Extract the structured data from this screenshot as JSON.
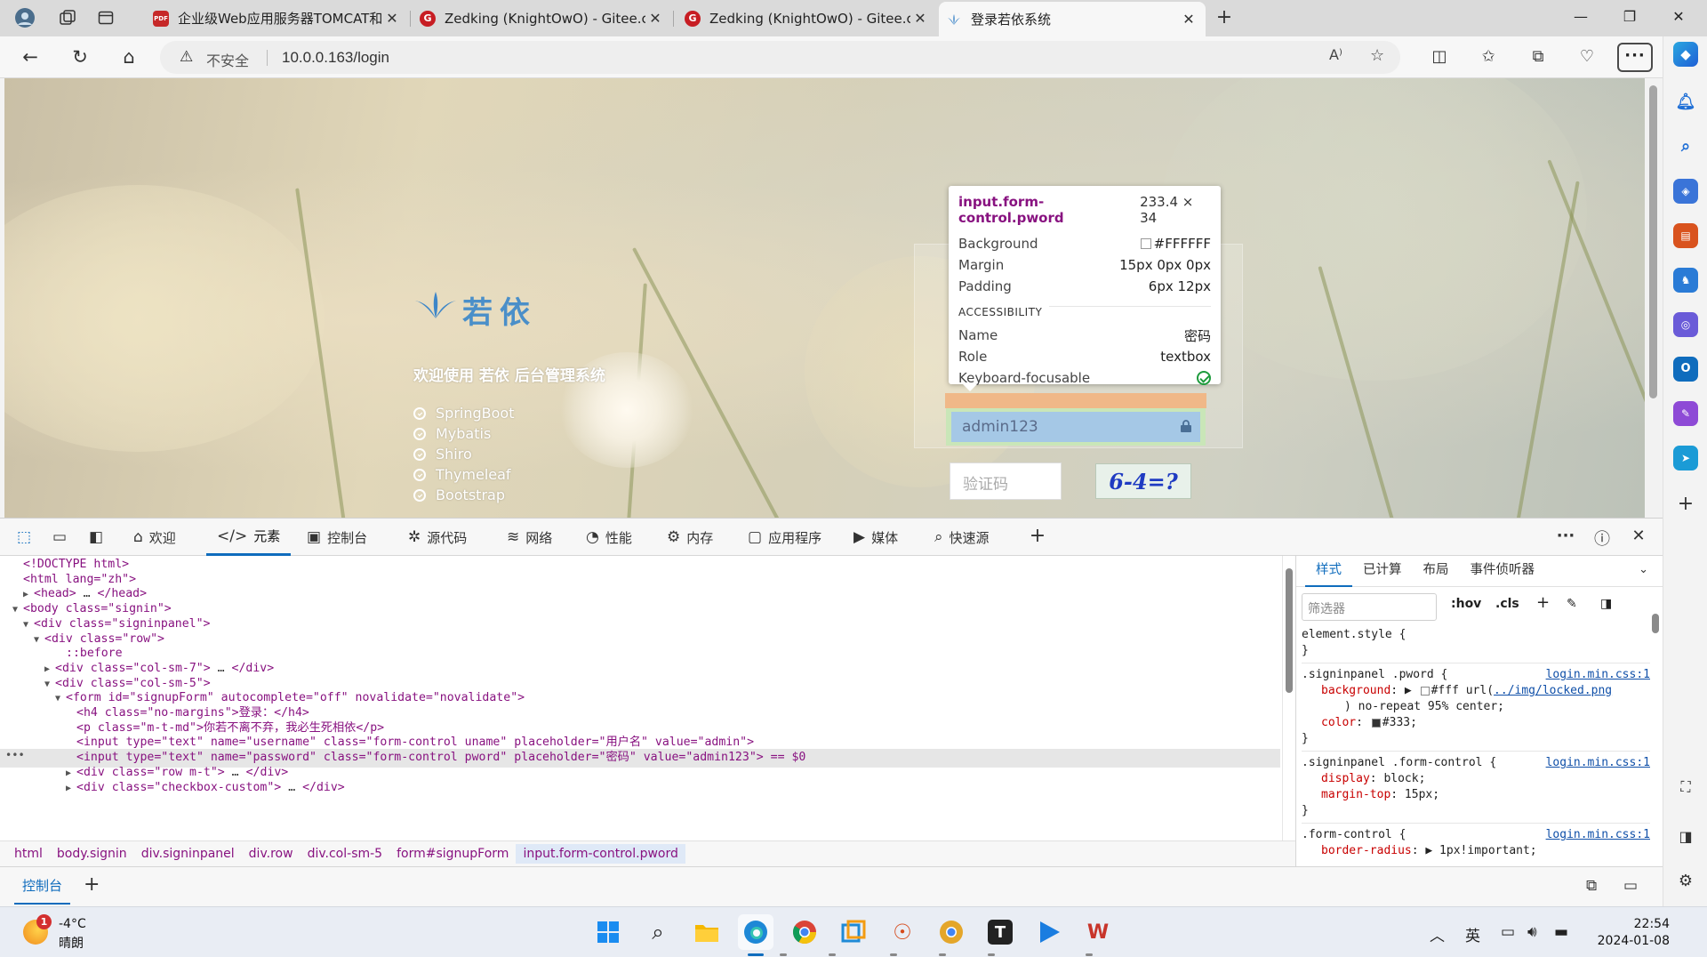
{
  "browser": {
    "tabs": [
      {
        "title": "企业级Web应用服务器TOMCAT和",
        "favicon_color": "#c62828",
        "favicon_glyph": "PDF",
        "active": false
      },
      {
        "title": "Zedking (KnightOwO) - Gitee.cor",
        "favicon_color": "#c71d23",
        "favicon_glyph": "G",
        "active": false
      },
      {
        "title": "Zedking (KnightOwO) - Gitee.cor",
        "favicon_color": "#c71d23",
        "favicon_glyph": "G",
        "active": false
      },
      {
        "title": "登录若依系统",
        "favicon_color": "#3d86c8",
        "favicon_glyph": "ruoyi-leaf-icon",
        "active": true
      }
    ],
    "address": {
      "security_label": "不安全",
      "url": "10.0.0.163/login"
    }
  },
  "page": {
    "logo_text": "若依",
    "welcome": "欢迎使用 若依 后台管理系统",
    "features": [
      "SpringBoot",
      "Mybatis",
      "Shiro",
      "Thymeleaf",
      "Bootstrap"
    ],
    "password_value": "admin123",
    "captcha_placeholder": "验证码",
    "captcha_text": "6-4=?"
  },
  "tooltip": {
    "selector": "input.form-control.pword",
    "size": "233.4 × 34",
    "rows": [
      {
        "label": "Background",
        "value": "#FFFFFF",
        "swatch": "#FFFFFF"
      },
      {
        "label": "Margin",
        "value": "15px 0px 0px"
      },
      {
        "label": "Padding",
        "value": "6px 12px"
      }
    ],
    "accessibility_title": "ACCESSIBILITY",
    "a11y_rows": [
      {
        "label": "Name",
        "value": "密码"
      },
      {
        "label": "Role",
        "value": "textbox"
      },
      {
        "label": "Keyboard-focusable",
        "value": ""
      }
    ]
  },
  "devtools": {
    "tabs": [
      {
        "label": "欢迎",
        "icon": "home-icon"
      },
      {
        "label": "元素",
        "icon": "code-icon",
        "active": true
      },
      {
        "label": "控制台",
        "icon": "console-icon"
      },
      {
        "label": "源代码",
        "icon": "bug-icon"
      },
      {
        "label": "网络",
        "icon": "wifi-icon"
      },
      {
        "label": "性能",
        "icon": "gauge-icon"
      },
      {
        "label": "内存",
        "icon": "memory-icon"
      },
      {
        "label": "应用程序",
        "icon": "app-icon"
      },
      {
        "label": "媒体",
        "icon": "play-icon"
      },
      {
        "label": "快速源",
        "icon": "quicksource-icon"
      }
    ],
    "dom_lines": [
      {
        "indent": 0,
        "twisty": "",
        "text": "<!DOCTYPE html>"
      },
      {
        "indent": 0,
        "twisty": "",
        "text": "<html lang=\"zh\">"
      },
      {
        "indent": 1,
        "twisty": "▶",
        "text": "<head>",
        "tail": "</head>",
        "collapsed": true
      },
      {
        "indent": 0,
        "twisty": "▼",
        "text": "<body class=\"signin\">"
      },
      {
        "indent": 1,
        "twisty": "▼",
        "text": "<div class=\"signinpanel\">"
      },
      {
        "indent": 2,
        "twisty": "▼",
        "text": "<div class=\"row\">"
      },
      {
        "indent": 4,
        "twisty": "",
        "text": "::before"
      },
      {
        "indent": 3,
        "twisty": "▶",
        "text": "<div class=\"col-sm-7\">",
        "tail": "</div>",
        "collapsed": true
      },
      {
        "indent": 3,
        "twisty": "▼",
        "text": "<div class=\"col-sm-5\">"
      },
      {
        "indent": 4,
        "twisty": "▼",
        "text": "<form id=\"signupForm\" autocomplete=\"off\" novalidate=\"novalidate\">"
      },
      {
        "indent": 5,
        "twisty": "",
        "text": "<h4 class=\"no-margins\">登录：</h4>"
      },
      {
        "indent": 5,
        "twisty": "",
        "text": "<p class=\"m-t-md\">你若不离不弃，我必生死相依</p>"
      },
      {
        "indent": 5,
        "twisty": "",
        "text": "<input type=\"text\" name=\"username\" class=\"form-control uname\" placeholder=\"用户名\" value=\"admin\">"
      },
      {
        "indent": 5,
        "twisty": "",
        "text": "<input type=\"text\" name=\"password\" class=\"form-control pword\" placeholder=\"密码\" value=\"admin123\"> == $0",
        "selected": true
      },
      {
        "indent": 5,
        "twisty": "▶",
        "text": "<div class=\"row m-t\">",
        "tail": "</div>",
        "collapsed": true
      },
      {
        "indent": 5,
        "twisty": "▶",
        "text": "<div class=\"checkbox-custom\">",
        "tail": "</div>",
        "collapsed": true
      }
    ],
    "breadcrumbs": [
      "html",
      "body.signin",
      "div.signinpanel",
      "div.row",
      "div.col-sm-5",
      "form#signupForm",
      "input.form-control.pword"
    ],
    "styles_tabs": [
      "样式",
      "已计算",
      "布局",
      "事件侦听器"
    ],
    "filter_placeholder": "筛选器",
    "hov_label": ":hov",
    "cls_label": ".cls",
    "drawer_tab": "控制台"
  },
  "taskbar": {
    "weather_temp": "-4°C",
    "weather_cond": "晴朗",
    "weather_badge": "1",
    "ime": "英",
    "time": "22:54",
    "date": "2024-01-08"
  }
}
